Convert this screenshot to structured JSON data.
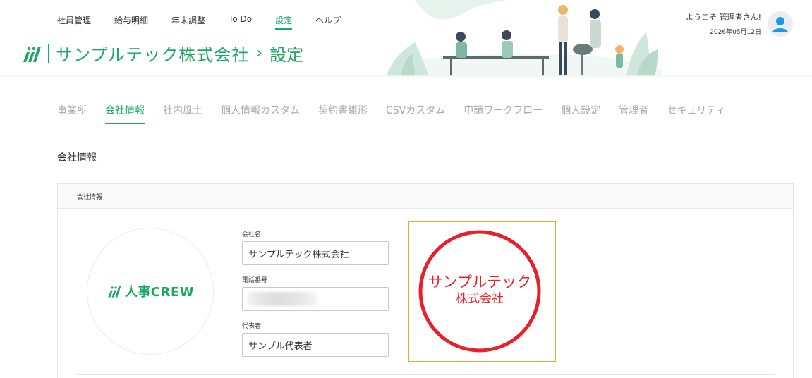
{
  "nav": {
    "items": [
      {
        "label": "社員管理",
        "active": false
      },
      {
        "label": "給与明細",
        "active": false
      },
      {
        "label": "年末調整",
        "active": false
      },
      {
        "label": "To Do",
        "active": false
      },
      {
        "label": "設定",
        "active": true
      },
      {
        "label": "ヘルプ",
        "active": false
      }
    ]
  },
  "brand": {
    "company": "サンプルテック株式会社",
    "separator": "›",
    "page": "設定"
  },
  "user": {
    "welcome": "ようこそ 管理者さん!",
    "date": "2026年05月12日"
  },
  "subtabs": [
    {
      "label": "事業所",
      "active": false
    },
    {
      "label": "会社情報",
      "active": true
    },
    {
      "label": "社内風土",
      "active": false
    },
    {
      "label": "個人情報カスタム",
      "active": false
    },
    {
      "label": "契約書雛形",
      "active": false
    },
    {
      "label": "CSVカスタム",
      "active": false
    },
    {
      "label": "申請ワークフロー",
      "active": false
    },
    {
      "label": "個人設定",
      "active": false
    },
    {
      "label": "管理者",
      "active": false
    },
    {
      "label": "セキュリティ",
      "active": false
    }
  ],
  "section": {
    "title": "会社情報"
  },
  "card": {
    "header": "会社情報",
    "logo_text": "人事CREW",
    "fields": {
      "company_name_label": "会社名",
      "company_name_value": "サンプルテック株式会社",
      "phone_label": "電話番号",
      "phone_value": "",
      "representative_label": "代表者",
      "representative_value": "サンプル代表者"
    },
    "seal": {
      "line1": "サンプルテック",
      "line2": "株式会社"
    }
  },
  "colors": {
    "accent": "#1aa864",
    "seal_red": "#e8202a",
    "seal_border": "#f2a33a"
  }
}
